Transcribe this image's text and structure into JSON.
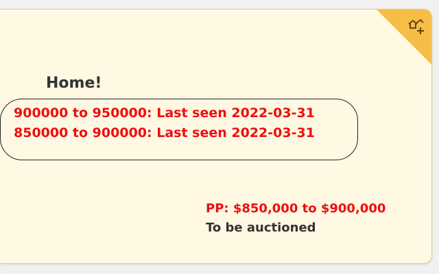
{
  "card": {
    "title": "Home!",
    "history": [
      "900000 to 950000: Last seen 2022-03-31",
      "850000 to 900000: Last seen 2022-03-31"
    ],
    "price": "PP: $850,000 to $900,000",
    "status": "To be auctioned",
    "corner_icon": "house-plus-icon"
  },
  "colors": {
    "card_bg": "#fff8e3",
    "card_border": "#f2cf6a",
    "corner": "#f7bd46",
    "red_text": "#ee0e0e",
    "dark_text": "#333333"
  }
}
